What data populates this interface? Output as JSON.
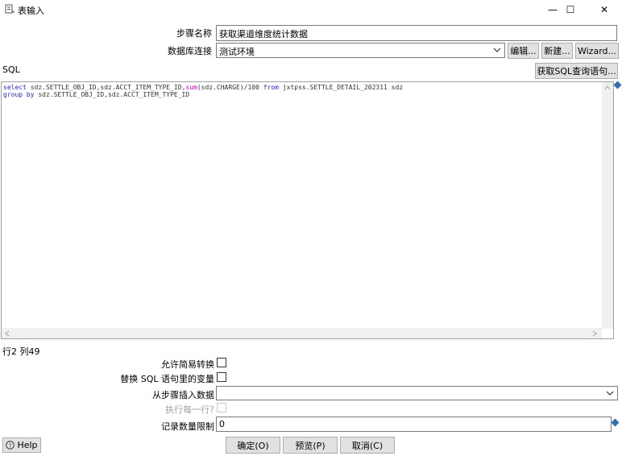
{
  "window": {
    "title": "表输入",
    "minimize_glyph": "—",
    "maximize_glyph": "☐",
    "close_glyph": "✕"
  },
  "form": {
    "step_name_label": "步骤名称",
    "step_name_value": "获取渠道维度统计数据",
    "db_conn_label": "数据库连接",
    "db_conn_value": "测试环境",
    "edit_label": "编辑...",
    "new_label": "新建...",
    "wizard_label": "Wizard...",
    "sql_label": "SQL",
    "get_sql_label": "获取SQL查询语句..."
  },
  "sql": {
    "line1": {
      "kw_select": "select",
      "t1": " sdz.SETTLE_OBJ_ID,sdz.ACCT_ITEM_TYPE_ID,",
      "fn_sum": "sum",
      "t2": "(sdz.CHARGE)/100 ",
      "kw_from": "from",
      "t3": " jxtpss.SETTLE_DETAIL_202311 sdz"
    },
    "line2": {
      "kw_group": "group by",
      "t1": " sdz.SETTLE_OBJ_ID,sdz.ACCT_ITEM_TYPE_ID"
    }
  },
  "status": {
    "position": "行2 列49"
  },
  "options": {
    "lazy_conversion_label": "允许简易转换",
    "replace_vars_label": "替换 SQL 语句里的变量",
    "insert_from_step_label": "从步骤插入数据",
    "insert_from_step_value": "",
    "exec_each_row_label": "执行每一行?",
    "limit_label": "记录数量限制",
    "limit_value": "0"
  },
  "buttons": {
    "help": "Help",
    "ok": "确定(O)",
    "preview": "预览(P)",
    "cancel": "取消(C)"
  },
  "icons": {
    "app": "table-input-icon",
    "variable": "variable-diamond-icon",
    "help": "help-icon"
  }
}
